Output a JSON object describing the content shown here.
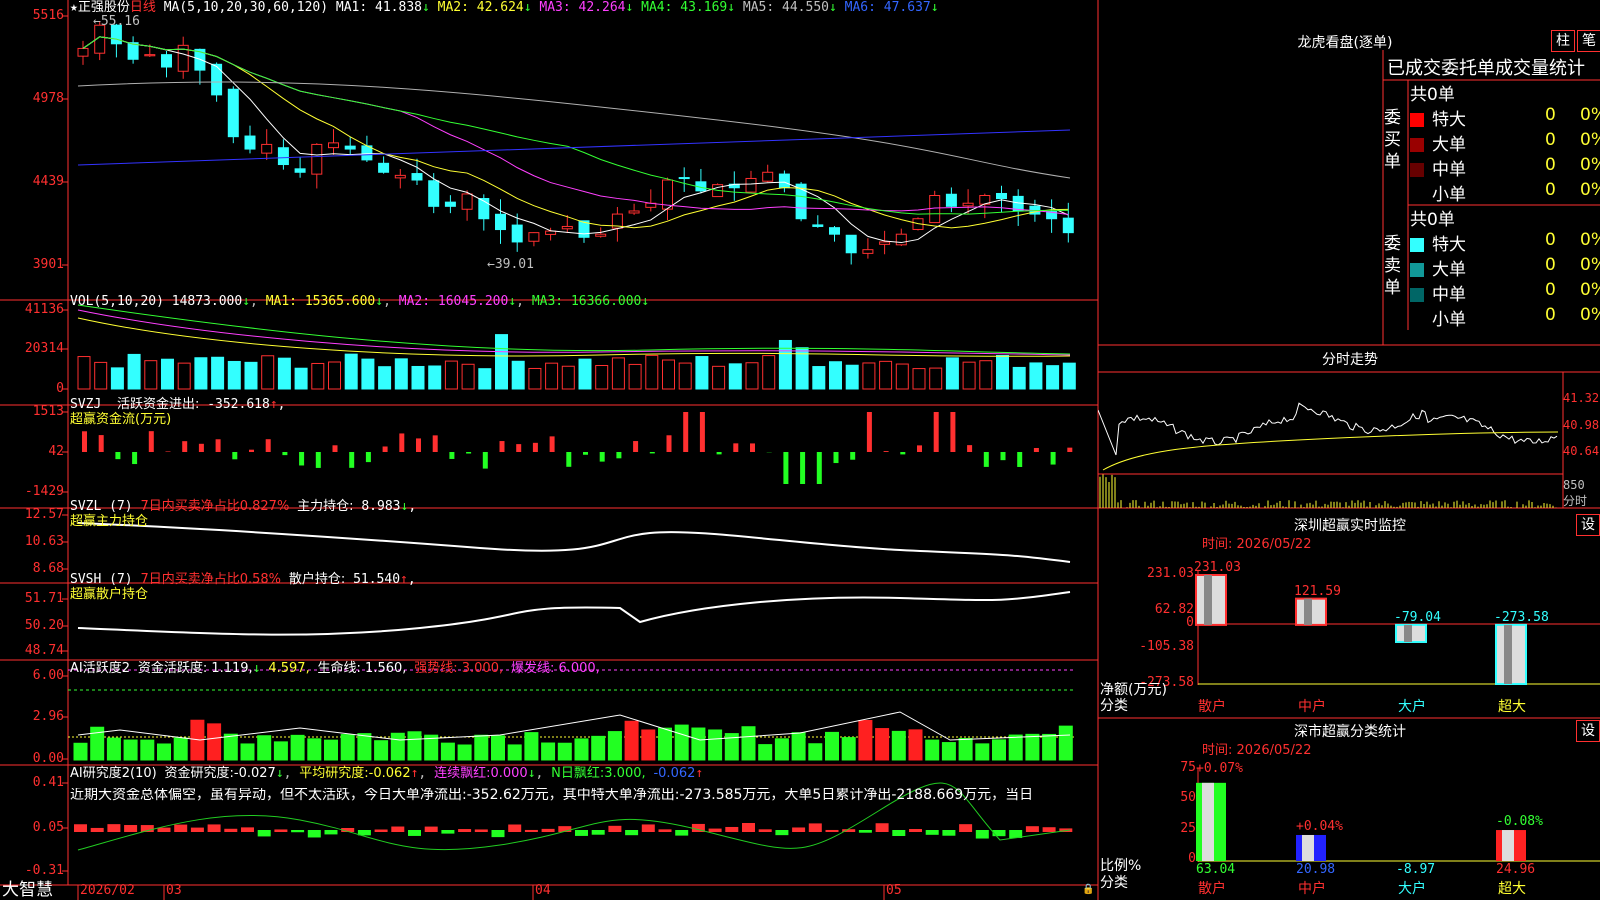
{
  "stock": {
    "name": "正强股份",
    "period": "日线",
    "prefix": "★"
  },
  "price_panel": {
    "ma_indicator": "MA(5,10,20,30,60,120)",
    "ma": [
      {
        "label": "MA1:",
        "value": "41.838",
        "arrow": "↓",
        "color": "#ffffff"
      },
      {
        "label": "MA2:",
        "value": "42.624",
        "arrow": "↓",
        "color": "#ffff33"
      },
      {
        "label": "MA3:",
        "value": "42.264",
        "arrow": "↓",
        "color": "#ff40ff"
      },
      {
        "label": "MA4:",
        "value": "43.169",
        "arrow": "↓",
        "color": "#33ff33"
      },
      {
        "label": "MA5:",
        "value": "44.550",
        "arrow": "↓",
        "color": "#c0c0c0"
      },
      {
        "label": "MA6:",
        "value": "47.637",
        "arrow": "↓",
        "color": "#3366ff"
      }
    ],
    "y_ticks": [
      "5516",
      "4978",
      "4439",
      "3901"
    ],
    "high_label": "←55.16",
    "low_label": "←39.01"
  },
  "vol_panel": {
    "indicator": "VOL(5,10,20)",
    "value": "14873.000",
    "arrow": "↓",
    "ma": [
      {
        "label": "MA1:",
        "value": "15365.600",
        "arrow": "↓",
        "color": "#ffff33"
      },
      {
        "label": "MA2:",
        "value": "16045.200",
        "arrow": "↓",
        "color": "#ff40ff"
      },
      {
        "label": "MA3:",
        "value": "16366.000",
        "arrow": "↓",
        "color": "#33ff33"
      }
    ],
    "y_ticks": [
      "41136",
      "20314",
      "0"
    ]
  },
  "svzj_panel": {
    "line1_name": "SVZJ",
    "line1_label": "活跃资金进出:",
    "line1_value": "-352.618",
    "line1_arrow": "↑",
    "line2": "超赢资金流(万元)",
    "y_ticks": [
      "1513",
      "42",
      "-1429"
    ]
  },
  "svzl_panel": {
    "name": "SVZL (7)",
    "desc": "7日内买卖净占比0.827%",
    "label": "主力持仓:",
    "value": "8.983",
    "arrow": "↓",
    "line2": "超赢主力持仓",
    "y_ticks": [
      "12.57",
      "10.63",
      "8.68"
    ]
  },
  "svsh_panel": {
    "name": "SVSH (7)",
    "desc": "7日内买卖净占比0.58%",
    "label": "散户持仓:",
    "value": "51.540",
    "arrow": "↑",
    "line2": "超赢散户持仓",
    "y_ticks": [
      "51.71",
      "50.20",
      "48.74"
    ]
  },
  "ai_active_panel": {
    "name": "AI活跃度2",
    "items": [
      {
        "label": "资金活跃度:",
        "value": "1.119",
        "arrow": "↓",
        "color": "#ffffff"
      },
      {
        "label": "",
        "value": "4.597",
        "arrow": "",
        "color": "#ffff33"
      },
      {
        "label": "生命线:",
        "value": "1.560",
        "arrow": "",
        "color": "#ffffff"
      },
      {
        "label": "强势线:",
        "value": "3.000",
        "arrow": "",
        "color": "#ff3030"
      },
      {
        "label": "爆发线:",
        "value": "6.000",
        "arrow": "",
        "color": "#ff40ff"
      }
    ],
    "y_ticks": [
      "6.00",
      "2.96",
      "0.00"
    ]
  },
  "ai_research_panel": {
    "name": "AI研究度2(10)",
    "items": [
      {
        "label": "资金研究度:",
        "value": "-0.027",
        "arrow": "↓",
        "color": "#ffffff"
      },
      {
        "label": "平均研究度:",
        "value": "-0.062",
        "arrow": "↑",
        "color": "#ffff33"
      },
      {
        "label": "连续飘红:",
        "value": "0.000",
        "arrow": "↓",
        "color": "#ff40ff"
      },
      {
        "label": "N日飘红:",
        "value": "3.000,",
        "arrow": "",
        "color": "#33ff33"
      },
      {
        "label": "",
        "value": "-0.062",
        "arrow": "↑",
        "color": "#3366ff"
      }
    ],
    "commentary": "近期大资金总体偏空，虽有异动，但不太活跃，今日大单净流出:-352.62万元，其中特大单净流出:-273.585万元，大单5日累计净出-2188.669万元，当日",
    "y_ticks": [
      "0.41",
      "0.05",
      "-0.31"
    ]
  },
  "x_axis": {
    "app_name": "大智慧",
    "labels": [
      "2026/02",
      "03",
      "04",
      "05"
    ]
  },
  "dragon_tiger": {
    "title": "龙虎看盘(逐单)",
    "btn1": "柱",
    "btn2": "笔",
    "table_title": "已成交委托单成交量统计",
    "buy_label": "委买单",
    "sell_label": "委卖单",
    "buy_total": "共0单",
    "sell_total": "共0单",
    "buy_rows": [
      {
        "name": "特大",
        "count": "0",
        "pct": "0%",
        "color": "#ff0000"
      },
      {
        "name": "大单",
        "count": "0",
        "pct": "0%",
        "color": "#990000"
      },
      {
        "name": "中单",
        "count": "0",
        "pct": "0%",
        "color": "#660000"
      },
      {
        "name": "小单",
        "count": "0",
        "pct": "0%",
        "color": "#000000"
      }
    ],
    "sell_rows": [
      {
        "name": "特大",
        "count": "0",
        "pct": "0%",
        "color": "#33ffff"
      },
      {
        "name": "大单",
        "count": "0",
        "pct": "0%",
        "color": "#119999"
      },
      {
        "name": "中单",
        "count": "0",
        "pct": "0%",
        "color": "#006666"
      },
      {
        "name": "小单",
        "count": "0",
        "pct": "0%",
        "color": "#000000"
      }
    ]
  },
  "intraday": {
    "title": "分时走势",
    "y_ticks": [
      "41.32",
      "40.98",
      "40.64"
    ],
    "vol_tick": "850",
    "vol_unit": "分时"
  },
  "sz_monitor": {
    "title": "深圳超赢实时监控",
    "btn": "设",
    "time_label": "时间:",
    "time_value": "2026/05/22",
    "y_ticks": [
      "231.03",
      "62.82",
      "0",
      "-105.38",
      "-273.58"
    ],
    "axis_label1": "净额(万元)",
    "axis_label2": "分类",
    "categories": [
      "散户",
      "中户",
      "大户",
      "超大"
    ],
    "values": [
      231.03,
      121.59,
      -79.04,
      -273.58
    ],
    "value_labels": [
      "231.03",
      "121.59",
      "-79.04",
      "-273.58"
    ]
  },
  "sz_category": {
    "title": "深市超赢分类统计",
    "btn": "设",
    "time_label": "时间:",
    "time_value": "2026/05/22",
    "y_ticks": [
      "75",
      "50",
      "25",
      "0"
    ],
    "axis_label1": "比例%",
    "axis_label2": "分类",
    "categories": [
      "散户",
      "中户",
      "大户",
      "超大"
    ],
    "change_labels": [
      "+0.07%",
      "+0.04%",
      "",
      "-0.08%"
    ],
    "values": [
      63.04,
      20.98,
      -8.97,
      24.96
    ],
    "value_labels": [
      "63.04",
      "20.98",
      "-8.97",
      "24.96"
    ]
  },
  "colors": {
    "up": "#ff3030",
    "down": "#33ffff",
    "grid": "#ff3030"
  }
}
